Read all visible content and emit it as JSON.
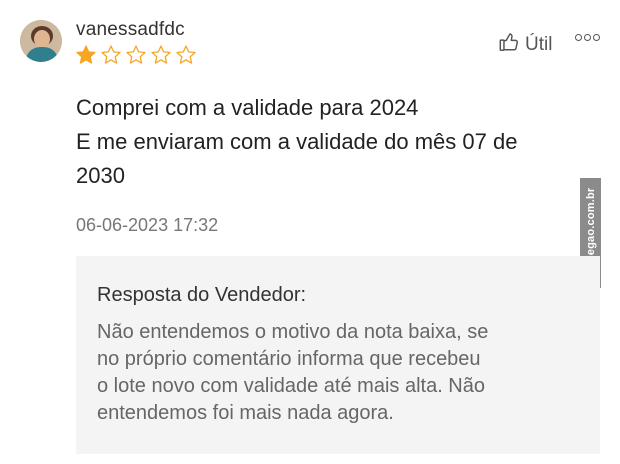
{
  "review": {
    "username": "vanessadfdc",
    "rating": 1,
    "rating_max": 5,
    "star_color": "#f5a623",
    "helpful_label": "Útil",
    "helpful_icon": "thumbs-up-icon",
    "more_icon": "more-options-icon",
    "avatar_icon": "user-avatar",
    "body_lines": [
      "Comprei com a validade para 2024",
      "E me enviaram com a validade do mês 07 de",
      "2030"
    ],
    "date": "06-06-2023 17:32"
  },
  "seller_response": {
    "title": "Resposta do Vendedor:",
    "lines": [
      "Não entendemos o motivo da nota baixa, se",
      "no próprio comentário informa que recebeu",
      "o lote novo com validade até mais alta. Não",
      "entendemos foi mais nada agora."
    ]
  },
  "watermark": {
    "text": "AhNegao.com.br"
  }
}
